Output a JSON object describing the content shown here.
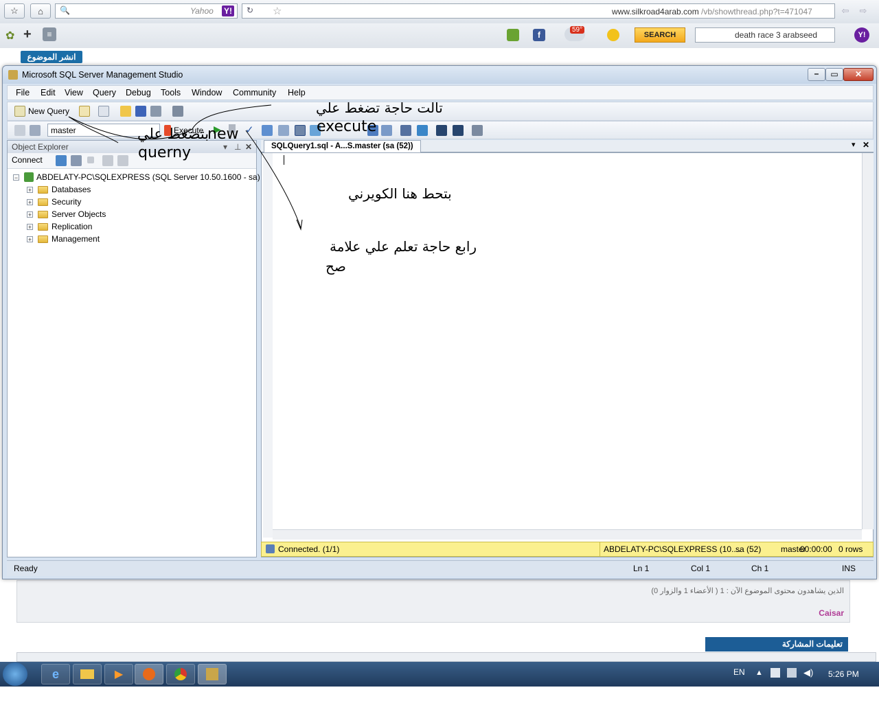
{
  "browser": {
    "search_engine": "Yahoo",
    "url_domain": "www.silkroad4arab.com",
    "url_path": "/vb/showthread.php?t=471047",
    "weather": "59°",
    "search_button": "SEARCH",
    "search_query": "death race 3 arabseed"
  },
  "page": {
    "post_topic_button": "انشر الموضوع",
    "viewers_text": "الذين يشاهدون محتوى الموضوع الآن : 1 ( الأعضاء 1 والزوار 0)",
    "viewer_name": "Caisar",
    "instructions_label": "تعليمات المشاركة"
  },
  "ssms": {
    "title": "Microsoft SQL Server Management Studio",
    "menu": [
      "File",
      "Edit",
      "View",
      "Query",
      "Debug",
      "Tools",
      "Window",
      "Community",
      "Help"
    ],
    "new_query_label": "New Query",
    "database_select": "master",
    "execute_label": "Execute",
    "object_explorer": {
      "title": "Object Explorer",
      "connect_label": "Connect",
      "server_node": "ABDELATY-PC\\SQLEXPRESS (SQL Server 10.50.1600 - sa)",
      "children": [
        "Databases",
        "Security",
        "Server Objects",
        "Replication",
        "Management"
      ]
    },
    "editor_tab": "SQLQuery1.sql - A...S.master (sa (52))",
    "connection_status": {
      "connected": "Connected. (1/1)",
      "server": "ABDELATY-PC\\SQLEXPRESS (10....",
      "user": "sa (52)",
      "database": "master",
      "time": "00:00:00",
      "rows": "0 rows"
    },
    "statusbar": {
      "ready": "Ready",
      "ln": "Ln 1",
      "col": "Col 1",
      "ch": "Ch 1",
      "mode": "INS"
    }
  },
  "annotations": {
    "step1_line1": "new",
    "step1_line2": "بتضغط علي",
    "step1_line3": "querny",
    "step3_line1": "تالت حاجة تضغط علي",
    "step3_line2": "execute",
    "step2": "بتحط هنا الكويرني",
    "step4_line1": "رابع حاجة تعلم علي علامة",
    "step4_line2": "صح"
  },
  "taskbar": {
    "language": "EN",
    "clock": "5:26 PM"
  },
  "colors": {
    "ssms_frame": "#d7e3f1",
    "status_yellow": "#fbf08f",
    "taskbar": "#1f3a5c",
    "forum_blue": "#1c5d96"
  }
}
